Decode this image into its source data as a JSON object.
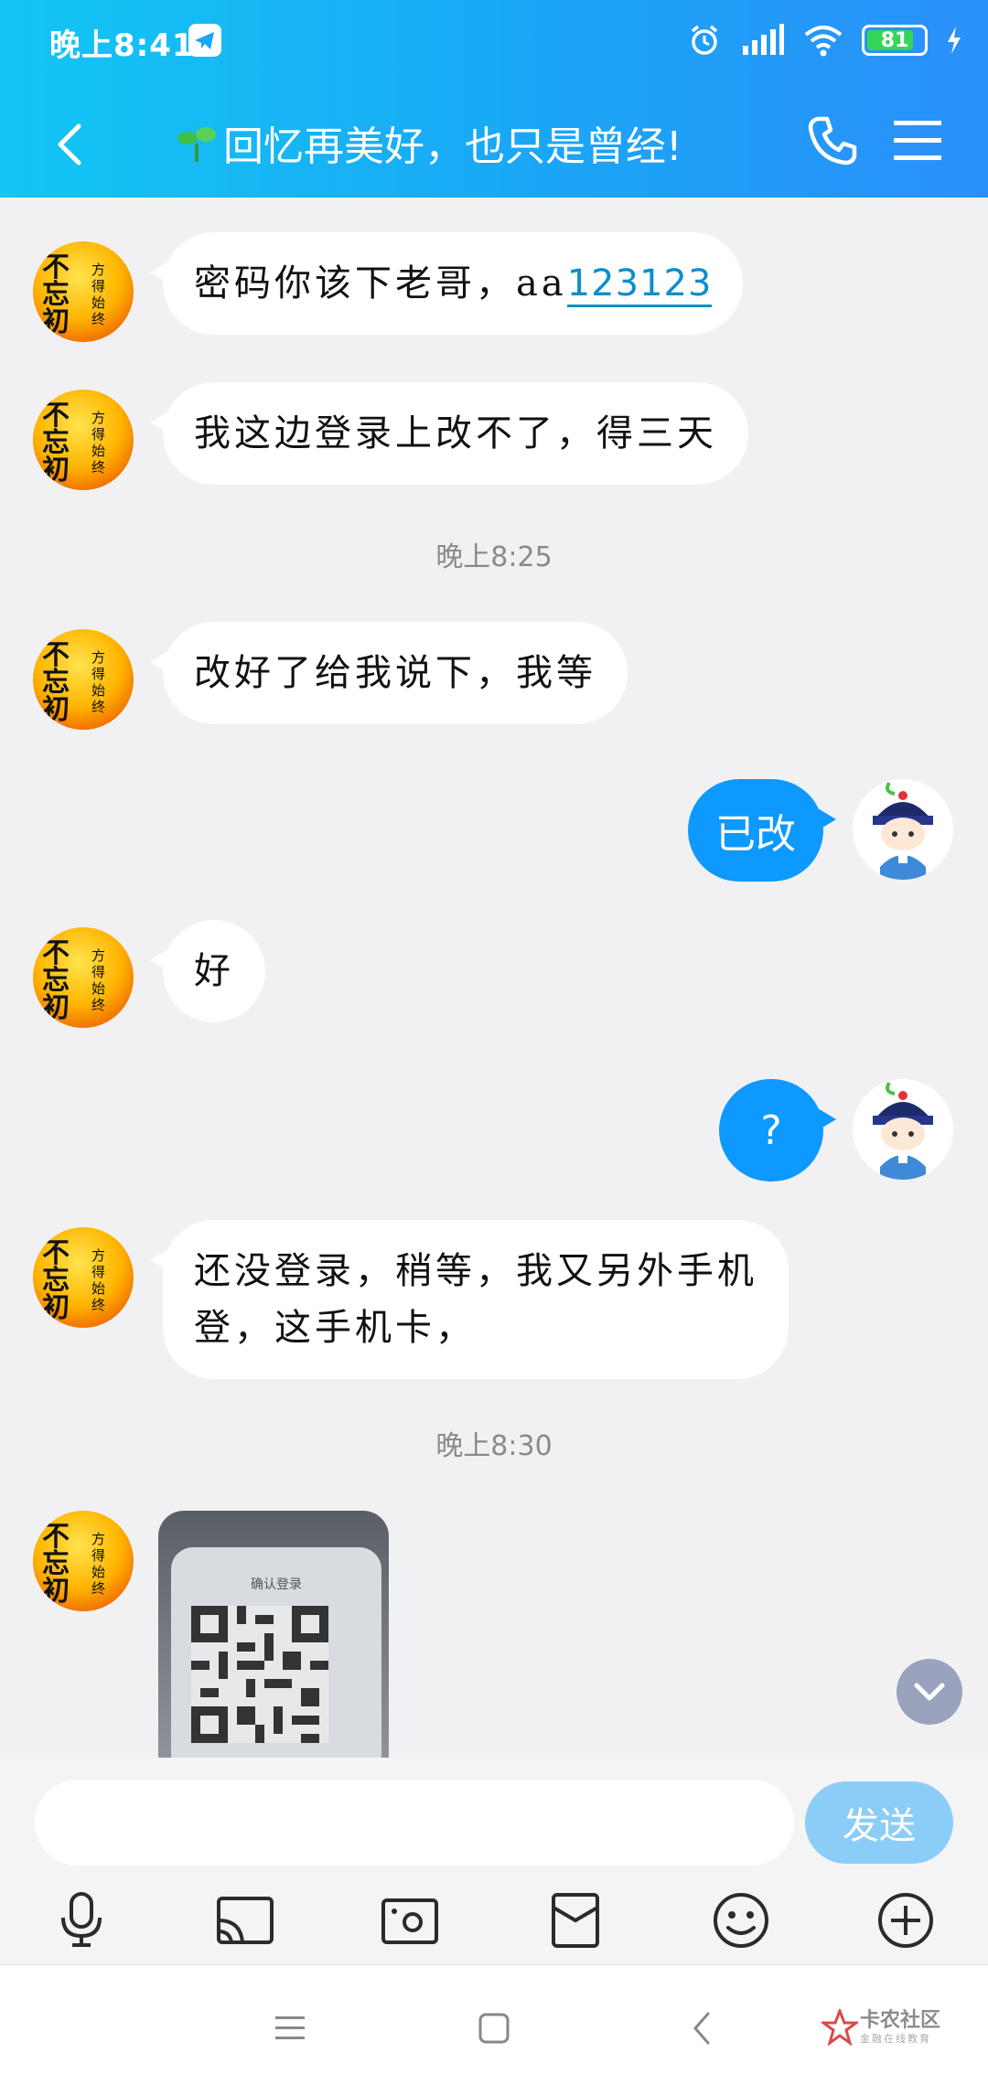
{
  "status_bar": {
    "time": "晚上8:41",
    "battery": "81"
  },
  "header": {
    "title": "回忆再美好，也只是曾经!"
  },
  "messages": [
    {
      "side": "left",
      "text": "密码你该下老哥，aa",
      "link": "123123"
    },
    {
      "side": "left",
      "text": "我这边登录上改不了，得三天"
    },
    {
      "side": "left",
      "text": "改好了给我说下，我等"
    },
    {
      "side": "right",
      "text": "已改"
    },
    {
      "side": "left",
      "text": "好"
    },
    {
      "side": "right",
      "text": "?"
    },
    {
      "side": "left",
      "line1": "还没登录，稍等，我又另外手机",
      "line2": "登，这手机卡，"
    }
  ],
  "timestamps": [
    "晚上8:25",
    "晚上8:30"
  ],
  "peer_avatar": {
    "big_text": "不忘初心",
    "small_text": "方得始终"
  },
  "image_message": {
    "screen_title": "确认登录"
  },
  "input": {
    "placeholder": "",
    "send_label": "发送"
  },
  "toolbar_icons": [
    "microphone-icon",
    "screen-share-icon",
    "photo-icon",
    "red-packet-icon",
    "emoji-icon",
    "plus-icon"
  ],
  "watermark": {
    "text": "卡农社区",
    "sub": "金融在线教育"
  },
  "colors": {
    "header_start": "#13c6f3",
    "header_end": "#2b8ffa",
    "bubble_right": "#0d99ff",
    "send_button": "#8ccdf7"
  }
}
